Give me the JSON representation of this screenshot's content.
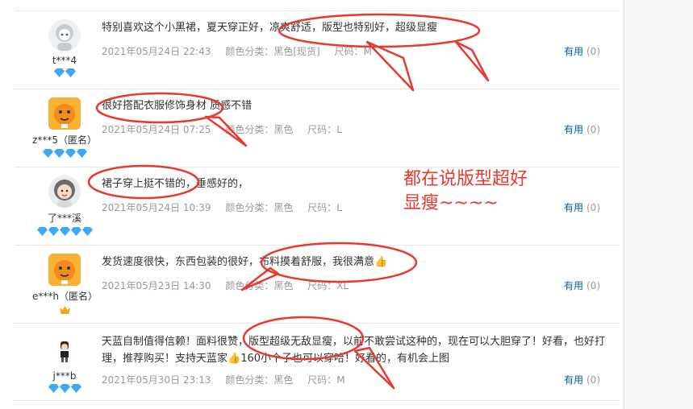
{
  "reviews": [
    {
      "user": "t***4",
      "text": "特别喜欢这个小黑裙，夏天穿正好，凉爽舒适，版型也特别好，超级显瘦",
      "date": "2021年05月24日 22:43",
      "color_label": "颜色分类：",
      "color": "黑色[现货]",
      "size_label": "尺码：",
      "size": "M",
      "useful_label": "有用",
      "useful_count": "(0)"
    },
    {
      "user": "z***5（匿名）",
      "text": "很好搭配衣服修饰身材 质感不错",
      "date": "2021年05月24日 07:25",
      "color_label": "颜色分类：",
      "color": "黑色",
      "size_label": "尺码：",
      "size": "L",
      "useful_label": "有用",
      "useful_count": "(0)"
    },
    {
      "user": "了***溪",
      "text": "裙子穿上挺不错的，垂感好的，",
      "date": "2021年05月24日 10:39",
      "color_label": "颜色分类：",
      "color": "黑色",
      "size_label": "尺码：",
      "size": "L",
      "useful_label": "有用",
      "useful_count": "(0)"
    },
    {
      "user": "e***h（匿名）",
      "text": "发货速度很快，东西包装的很好，布料摸着舒服，我很满意",
      "date": "2021年05月23日 14:30",
      "color_label": "颜色分类：",
      "color": "黑色",
      "size_label": "尺码：",
      "size": "XL",
      "useful_label": "有用",
      "useful_count": "(0)"
    },
    {
      "user": "j***b",
      "text": "天蓝自制值得信赖！面料很赞，版型超级无敌显瘦，以前不敢尝试这种的，现在可以大胆穿了！好看，也好打理，推荐购买！支持天蓝家",
      "text_tail": "160小个子也可以穿哈！好看的，有机会上图",
      "date": "2021年05月30日 23:13",
      "color_label": "颜色分类：",
      "color": "黑色",
      "size_label": "尺码：",
      "size": "M",
      "useful_label": "有用",
      "useful_count": "(0)"
    }
  ],
  "annotation": {
    "line1": "都在说版型超好",
    "line2": "显瘦~~~~"
  },
  "colors": {
    "annotation_red": "#e8392f",
    "link_blue": "#005ea7",
    "diamond_blue": "#3ea8f5",
    "crown_gold": "#f3a51c"
  }
}
